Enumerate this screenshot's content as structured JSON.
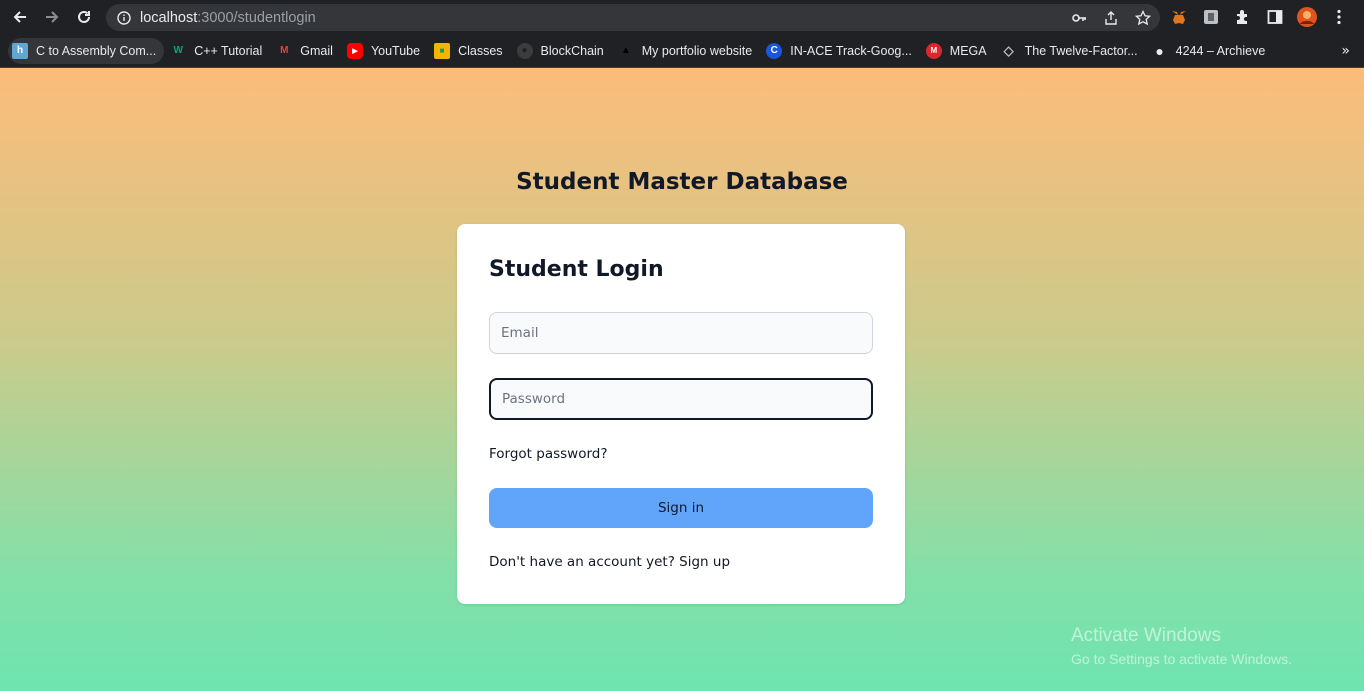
{
  "browser": {
    "url_host": "localhost",
    "url_path": ":3000/studentlogin",
    "icons": [
      "back-arrow-icon",
      "forward-arrow-icon",
      "reload-icon",
      "site-info-icon",
      "key-icon",
      "share-icon",
      "star-icon",
      "metamask-extension-icon",
      "extension-icon",
      "puzzle-extensions-icon",
      "side-panel-icon",
      "profile-avatar-icon",
      "more-menu-icon"
    ]
  },
  "bookmarks": [
    {
      "label": "C to Assembly Com...",
      "icon": "godbolt-icon",
      "color": "#5fa8d3",
      "glyph": "h"
    },
    {
      "label": "C++ Tutorial",
      "icon": "w3-tutorial-icon",
      "color": "#04aa6d",
      "glyph": "W"
    },
    {
      "label": "Gmail",
      "icon": "gmail-icon",
      "color": "#ea4335",
      "glyph": "M"
    },
    {
      "label": "YouTube",
      "icon": "youtube-icon",
      "color": "#ff0000",
      "glyph": "▶"
    },
    {
      "label": "Classes",
      "icon": "classroom-icon",
      "color": "#f4b400",
      "glyph": "■"
    },
    {
      "label": "BlockChain",
      "icon": "github-icon",
      "color": "#3c3c3c",
      "glyph": "●"
    },
    {
      "label": "My portfolio website",
      "icon": "portfolio-icon",
      "color": "#000000",
      "glyph": "▲"
    },
    {
      "label": "IN-ACE Track-Goog...",
      "icon": "inace-icon",
      "color": "#1a56db",
      "glyph": "C"
    },
    {
      "label": "MEGA",
      "icon": "mega-icon",
      "color": "#d9272e",
      "glyph": "M"
    },
    {
      "label": "The Twelve-Factor...",
      "icon": "twelve-factor-icon",
      "color": "#9aa0a6",
      "glyph": "◇"
    },
    {
      "label": "4244 – Archieve",
      "icon": "globe-icon",
      "color": "#e8eaed",
      "glyph": "●"
    }
  ],
  "bookmarks_more": "»",
  "app": {
    "title": "Student Master Database",
    "card_title": "Student Login",
    "email_placeholder": "Email",
    "password_placeholder": "Password",
    "forgot_password": "Forgot password?",
    "sign_in": "Sign in",
    "signup_prompt": "Don't have an account yet?",
    "signup_link": "Sign up"
  },
  "watermark": {
    "title": "Activate Windows",
    "subtitle": "Go to Settings to activate Windows."
  },
  "colors": {
    "gradient_top": "#fcbc7a",
    "gradient_bottom": "#6ee4b0",
    "button": "#60a5fa",
    "browser_chrome": "#202124"
  }
}
